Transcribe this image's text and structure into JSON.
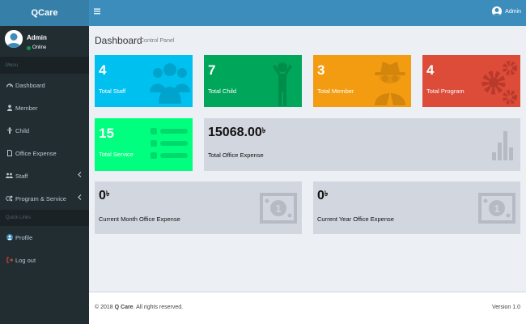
{
  "app": {
    "logo": "QCare"
  },
  "user": {
    "name": "Admin",
    "status": "Online"
  },
  "sidebar": {
    "menu_header": "Menu",
    "items": [
      {
        "label": "Dashboard",
        "icon": "dashboard-icon"
      },
      {
        "label": "Member",
        "icon": "user-icon"
      },
      {
        "label": "Child",
        "icon": "child-icon"
      },
      {
        "label": "Office Expense",
        "icon": "file-icon"
      },
      {
        "label": "Staff",
        "icon": "users-icon"
      },
      {
        "label": "Program & Service",
        "icon": "cogs-icon"
      }
    ],
    "quick_header": "Quick Links",
    "quick_items": [
      {
        "label": "Profile",
        "icon": "profile-icon"
      },
      {
        "label": "Log out",
        "icon": "logout-icon"
      }
    ]
  },
  "topbar": {
    "user_label": "Admin",
    "menu_icon": "hamburger-icon"
  },
  "page": {
    "title": "Dashboard",
    "subtitle": "Control Panel"
  },
  "stats": {
    "staff": {
      "value": "4",
      "label": "Total Staff"
    },
    "child": {
      "value": "7",
      "label": "Total Child"
    },
    "member": {
      "value": "3",
      "label": "Total Member"
    },
    "program": {
      "value": "4",
      "label": "Total Program"
    },
    "service": {
      "value": "15",
      "label": "Total Service"
    },
    "office_expense": {
      "value": "15068.00",
      "label": "Total Office Expense"
    },
    "month_expense": {
      "value": "0",
      "label": "Current Month Office Expense"
    },
    "year_expense": {
      "value": "0",
      "label": "Current Year Office Expense"
    },
    "currency": "৳"
  },
  "footer": {
    "copyright_prefix": "© 2018 ",
    "brand": "Q Care",
    "copyright_suffix": ". All rights reserved.",
    "version": "Version 1.0"
  },
  "colors": {
    "sidebar": "#222d32",
    "topbar": "#3c8dbc",
    "logo_bg": "#367fa9",
    "staff": "#00c0ef",
    "child": "#00a65a",
    "member": "#f39c12",
    "program": "#dd4b39",
    "service": "#00ff7f",
    "neutral": "#d2d6de"
  }
}
